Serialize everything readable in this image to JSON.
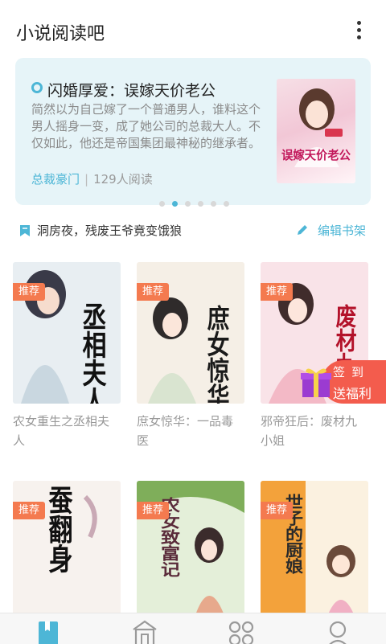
{
  "app": {
    "title": "小说阅读吧"
  },
  "banner": {
    "title": "闪婚厚爱：误嫁天价老公",
    "description": "简然以为自己嫁了一个普通男人，谁料这个男人摇身一变，成了她公司的总裁大人。不仅如此，他还是帝国集团最神秘的继承者。",
    "tag": "总裁豪门",
    "readers": "129人阅读",
    "cover_text": "误嫁天价老公",
    "slide_count": 6,
    "active_slide": 2
  },
  "notice": {
    "text": "洞房夜，残废王爷竟变饿狼"
  },
  "edit_shelf": {
    "label": "编辑书架"
  },
  "badge_label": "推荐",
  "books": [
    {
      "title": "农女重生之丞相夫人",
      "cover_text": "丞相夫人"
    },
    {
      "title": "庶女惊华：一品毒医",
      "cover_text": "庶女惊华"
    },
    {
      "title": "邪帝狂后：废材九小姐",
      "cover_text": "废材九小"
    },
    {
      "title": "",
      "cover_text": "蚕翻身"
    },
    {
      "title": "",
      "cover_text": "农女致富记"
    },
    {
      "title": "",
      "cover_text": "世子的厨娘"
    }
  ],
  "welfare": {
    "line1": "签到",
    "line2": "送福利"
  },
  "colors": {
    "accent": "#4db6d6",
    "badge": "#f47a4f",
    "welfare": "#f35c4d"
  },
  "tabs": [
    {
      "icon": "bookshelf-icon",
      "active": true
    },
    {
      "icon": "bookstore-icon",
      "active": false
    },
    {
      "icon": "category-icon",
      "active": false
    },
    {
      "icon": "profile-icon",
      "active": false
    }
  ]
}
